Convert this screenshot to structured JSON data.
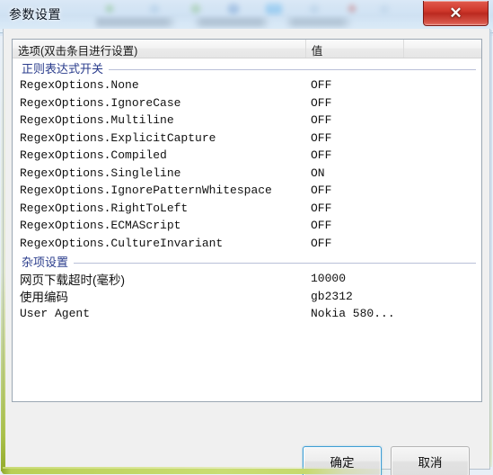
{
  "window": {
    "title": "参数设置",
    "close_label": "✕",
    "close_icon": "close-icon"
  },
  "listview": {
    "columns": [
      {
        "label": "选项(双击条目进行设置)"
      },
      {
        "label": "值"
      },
      {
        "label": ""
      }
    ],
    "groups": [
      {
        "name": "正则表达式开关",
        "rows": [
          {
            "option": "RegexOptions.None",
            "value": "OFF",
            "cjk": false
          },
          {
            "option": "RegexOptions.IgnoreCase",
            "value": "OFF",
            "cjk": false
          },
          {
            "option": "RegexOptions.Multiline",
            "value": "OFF",
            "cjk": false
          },
          {
            "option": "RegexOptions.ExplicitCapture",
            "value": "OFF",
            "cjk": false
          },
          {
            "option": "RegexOptions.Compiled",
            "value": "OFF",
            "cjk": false
          },
          {
            "option": "RegexOptions.Singleline",
            "value": "ON",
            "cjk": false
          },
          {
            "option": "RegexOptions.IgnorePatternWhitespace",
            "value": "OFF",
            "cjk": false
          },
          {
            "option": "RegexOptions.RightToLeft",
            "value": "OFF",
            "cjk": false
          },
          {
            "option": "RegexOptions.ECMAScript",
            "value": "OFF",
            "cjk": false
          },
          {
            "option": "RegexOptions.CultureInvariant",
            "value": "OFF",
            "cjk": false
          }
        ]
      },
      {
        "name": "杂项设置",
        "rows": [
          {
            "option": "网页下载超时(毫秒)",
            "value": "10000",
            "cjk": true
          },
          {
            "option": "使用编码",
            "value": "gb2312",
            "cjk": true
          },
          {
            "option": "User Agent",
            "value": "Nokia 580...",
            "cjk": false
          }
        ]
      }
    ]
  },
  "buttons": {
    "ok": "确定",
    "cancel": "取消"
  },
  "colors": {
    "close_red": "#d1392c",
    "group_header_text": "#2a3c8c",
    "default_button_border": "#3c9dd4",
    "bottom_glow": "#c6d96d"
  }
}
